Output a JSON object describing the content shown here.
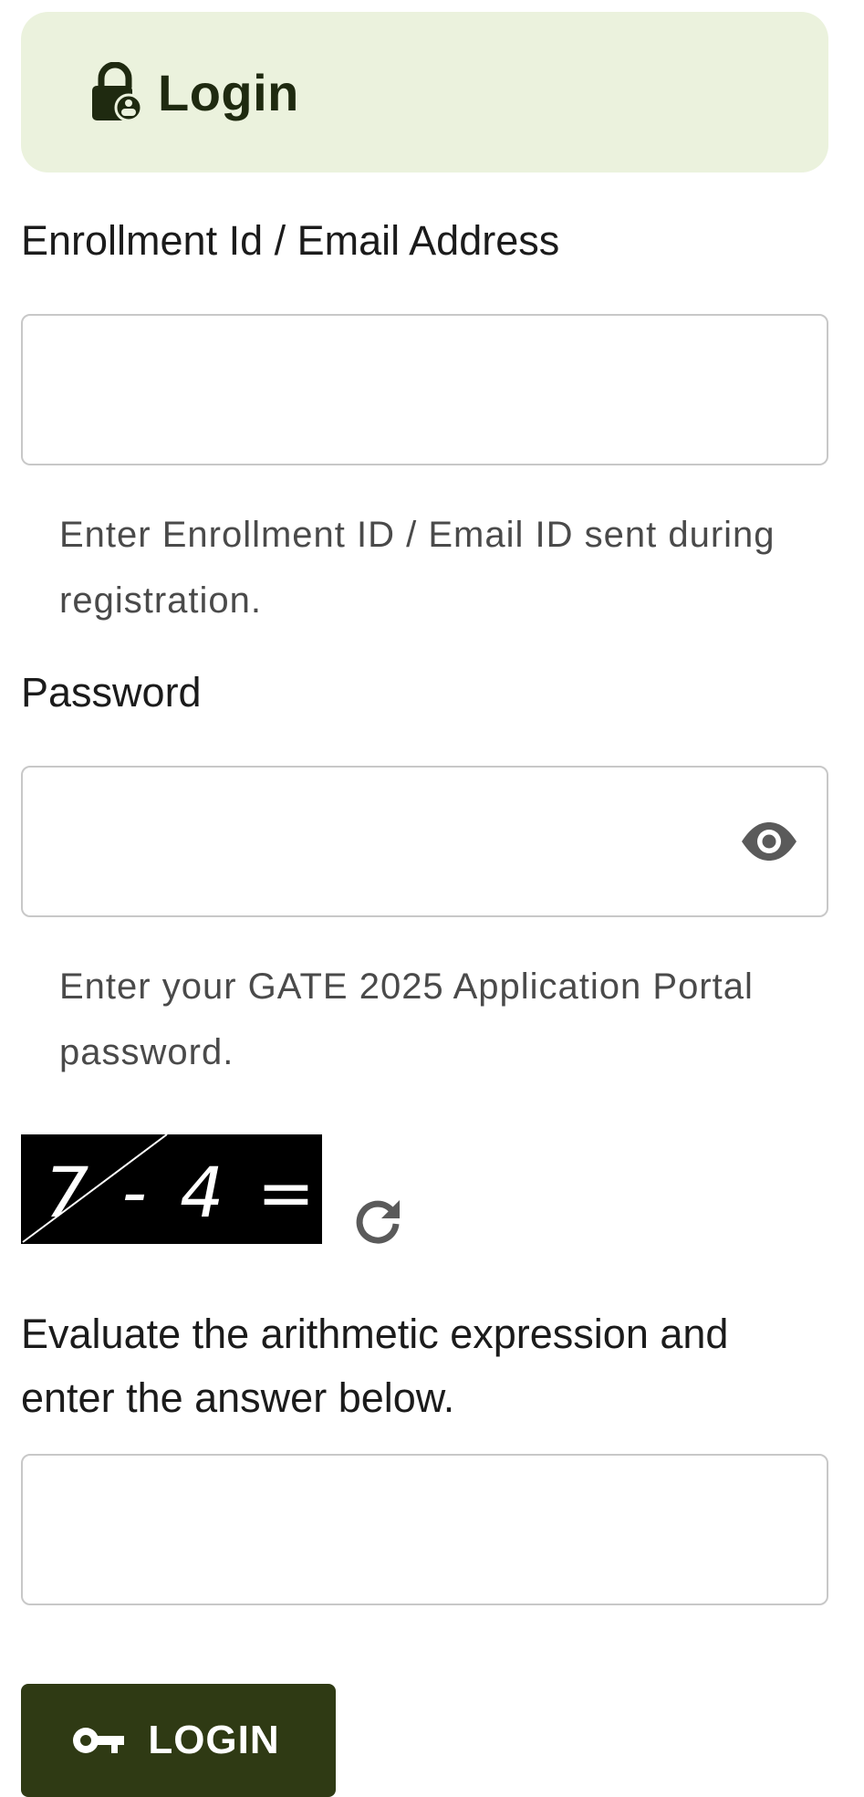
{
  "header": {
    "title": "Login",
    "icon": "lock-icon"
  },
  "enrollment": {
    "label": "Enrollment Id / Email Address",
    "value": "",
    "placeholder": "",
    "helper": "Enter Enrollment ID / Email ID sent during registration."
  },
  "password": {
    "label": "Password",
    "value": "",
    "placeholder": "",
    "helper": "Enter your GATE 2025 Application Portal password.",
    "toggle_icon": "eye-icon"
  },
  "captcha": {
    "expression": "7 - 4 =",
    "refresh_icon": "refresh-icon",
    "instructions": "Evaluate the arithmetic expression and enter the answer below.",
    "value": "",
    "placeholder": ""
  },
  "login_button": {
    "label": "LOGIN",
    "icon": "key-icon"
  },
  "colors": {
    "header_bg": "#ebf2dd",
    "header_text": "#1f2a10",
    "button_bg": "#2f3a14",
    "input_border": "#c8c8c8",
    "helper_text": "#4a4a4a"
  }
}
